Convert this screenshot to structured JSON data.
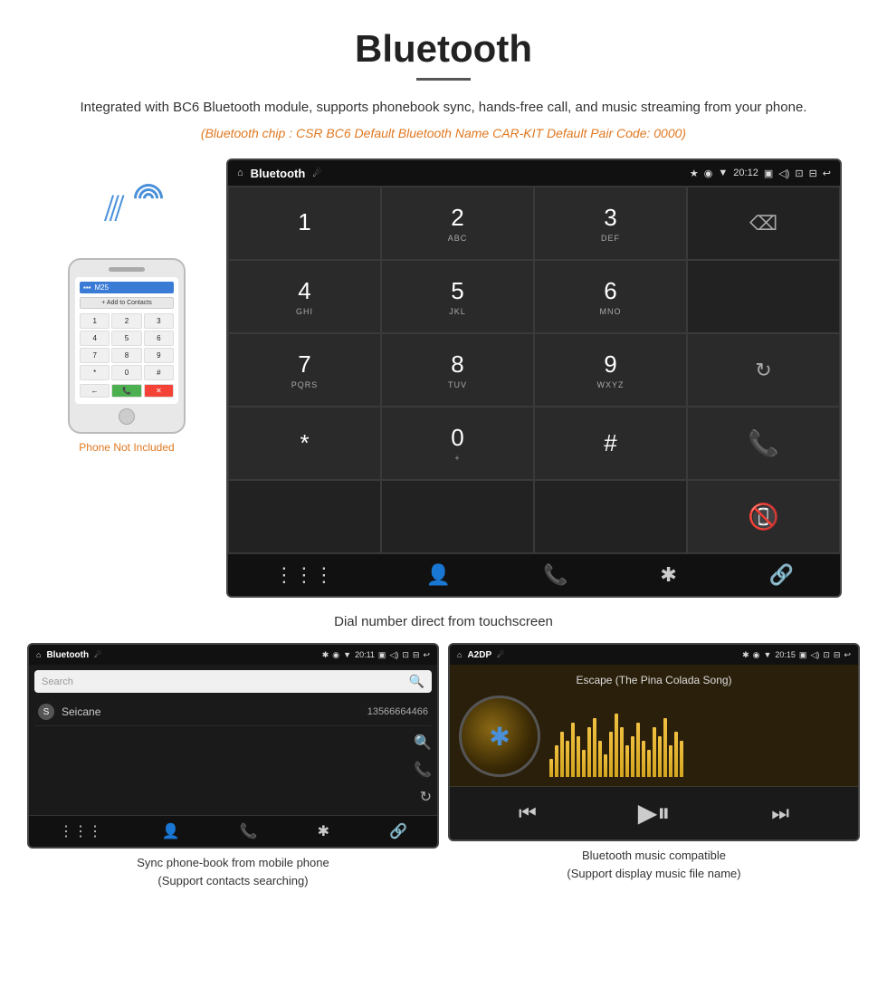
{
  "title": "Bluetooth",
  "description": "Integrated with BC6 Bluetooth module, supports phonebook sync, hands-free call, and music streaming from your phone.",
  "specs": "(Bluetooth chip : CSR BC6    Default Bluetooth Name CAR-KIT    Default Pair Code: 0000)",
  "dial_caption": "Dial number direct from touchscreen",
  "phone_not_included": "Phone Not Included",
  "phonebook_caption": "Sync phone-book from mobile phone\n(Support contacts searching)",
  "music_caption": "Bluetooth music compatible\n(Support display music file name)",
  "dial_screen": {
    "app_name": "Bluetooth",
    "time": "20:12",
    "keys": [
      {
        "main": "1",
        "sub": ""
      },
      {
        "main": "2",
        "sub": "ABC"
      },
      {
        "main": "3",
        "sub": "DEF"
      },
      {
        "main": "",
        "sub": "",
        "type": "empty"
      },
      {
        "main": "4",
        "sub": "GHI"
      },
      {
        "main": "5",
        "sub": "JKL"
      },
      {
        "main": "6",
        "sub": "MNO"
      },
      {
        "main": "",
        "sub": "",
        "type": "empty"
      },
      {
        "main": "7",
        "sub": "PQRS"
      },
      {
        "main": "8",
        "sub": "TUV"
      },
      {
        "main": "9",
        "sub": "WXYZ"
      },
      {
        "main": "",
        "sub": "",
        "type": "refresh"
      },
      {
        "main": "*",
        "sub": ""
      },
      {
        "main": "0",
        "sub": "+"
      },
      {
        "main": "#",
        "sub": ""
      },
      {
        "main": "",
        "sub": "",
        "type": "call-green"
      },
      {
        "main": "",
        "sub": "",
        "type": "empty"
      },
      {
        "main": "",
        "sub": "",
        "type": "empty"
      },
      {
        "main": "",
        "sub": "",
        "type": "empty"
      },
      {
        "main": "",
        "sub": "",
        "type": "call-red"
      }
    ],
    "nav_icons": [
      "grid",
      "person",
      "phone",
      "bluetooth",
      "link"
    ]
  },
  "phonebook_screen": {
    "app_name": "Bluetooth",
    "time": "20:11",
    "search_placeholder": "Search",
    "contact_letter": "S",
    "contact_name": "Seicane",
    "contact_number": "13566664466"
  },
  "music_screen": {
    "app_name": "A2DP",
    "time": "20:15",
    "song_title": "Escape (The Pina Colada Song)",
    "viz_heights": [
      20,
      35,
      50,
      40,
      60,
      45,
      30,
      55,
      65,
      40,
      25,
      50,
      70,
      55,
      35,
      45,
      60,
      40,
      30,
      55,
      45,
      65,
      35,
      50,
      40
    ]
  }
}
